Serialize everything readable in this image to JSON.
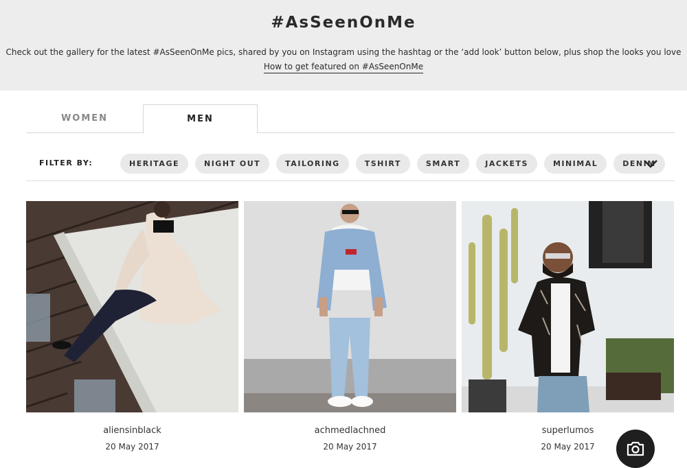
{
  "header": {
    "title": "#AsSeenOnMe",
    "description": "Check out the gallery for the latest #AsSeenOnMe pics, shared by you on Instagram using the hashtag or the ‘add look’ button below, plus shop the looks you love",
    "howto_link": "How to get featured on #AsSeenOnMe"
  },
  "tabs": [
    {
      "label": "WOMEN",
      "active": false
    },
    {
      "label": "MEN",
      "active": true
    }
  ],
  "filter": {
    "label": "FILTER BY:",
    "chips": [
      "HERITAGE",
      "NIGHT OUT",
      "TAILORING",
      "TSHIRT",
      "SMART",
      "JACKETS",
      "MINIMAL",
      "DENIM"
    ],
    "expand_icon": "chevron-down-icon"
  },
  "gallery": [
    {
      "username": "aliensinblack",
      "date": "20 May 2017"
    },
    {
      "username": "achmedlachned",
      "date": "20 May 2017"
    },
    {
      "username": "superlumos",
      "date": "20 May 2017"
    }
  ],
  "add_look_button": {
    "icon": "camera-icon"
  },
  "colors": {
    "hero_bg": "#ededed",
    "chip_bg": "#e9e9e9",
    "camera_button": "#1f1f1f"
  }
}
